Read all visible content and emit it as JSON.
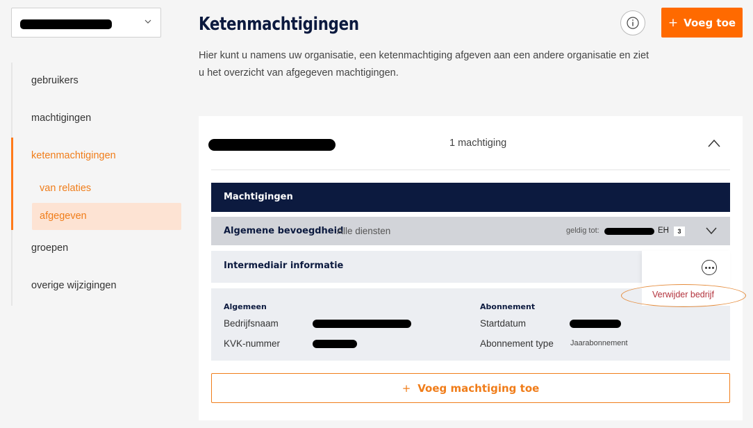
{
  "org_selector": {
    "selected_value_redacted": true
  },
  "sidebar": {
    "items": [
      {
        "label": "gebruikers"
      },
      {
        "label": "machtigingen"
      },
      {
        "label": "ketenmachtigingen"
      },
      {
        "label": "groepen"
      },
      {
        "label": "overige wijzigingen"
      }
    ],
    "subitems": [
      {
        "label": "van relaties"
      },
      {
        "label": "afgegeven"
      }
    ],
    "active_item": "ketenmachtigingen",
    "active_subitem": "afgegeven"
  },
  "header": {
    "title": "Ketenmachtigingen",
    "intro": "Hier kunt u namens uw organisatie, een ketenmachtiging afgeven aan een andere organisatie en ziet u het overzicht van afgegeven machtigingen.",
    "add_label": "Voeg toe",
    "add_icon": "plus-icon",
    "info_icon": "info-icon"
  },
  "card": {
    "count_label": "1 machtiging",
    "section_title": "Machtigingen",
    "authority": {
      "title": "Algemene bevoegdheid",
      "scope": "Alle diensten",
      "valid_label": "geldig tot:",
      "level_label": "EH",
      "level_value": "3"
    },
    "intermediary": {
      "title": "Intermediair informatie",
      "menu_item": "Verwijder bedrijf"
    },
    "details": {
      "general_heading": "Algemeen",
      "company_name_label": "Bedrijfsnaam",
      "kvk_label": "KVK-nummer",
      "subscription_heading": "Abonnement",
      "start_date_label": "Startdatum",
      "subscription_type_label": "Abonnement type",
      "subscription_type_value": "Jaarabonnement"
    },
    "add_mandate_label": "Voeg machtiging toe"
  },
  "colors": {
    "accent": "#ff6a00",
    "navy": "#0c1a3f",
    "active_bg": "#fde3d3",
    "danger": "#b3323c"
  }
}
